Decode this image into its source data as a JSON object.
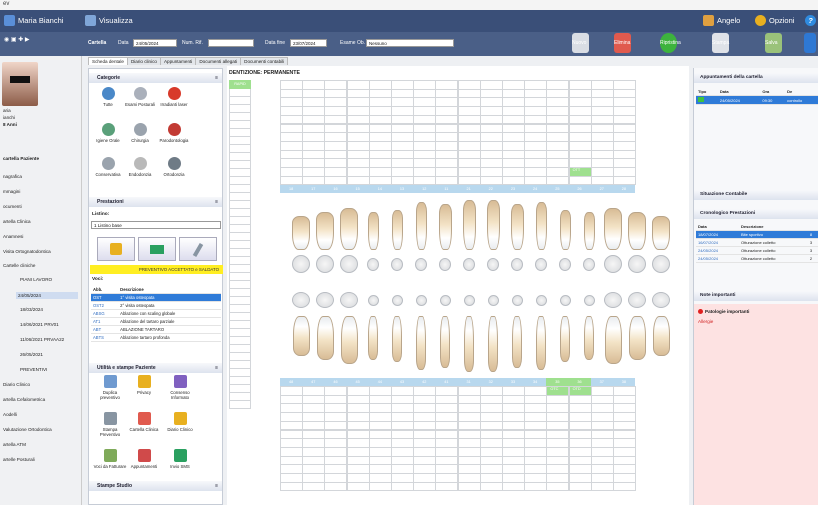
{
  "window": {
    "title": "ev"
  },
  "topbar": {
    "user": "Maria Bianchi",
    "view": "Visualizza",
    "operator": "Angelo",
    "options": "Opzioni",
    "help": "?"
  },
  "toolbar": {
    "cartella": "Cartella",
    "data_label": "Data",
    "data_value": "24/05/2024",
    "num_label": "Num. Rif.",
    "num_value": "",
    "data_fine_label": "Data fine",
    "data_fine_value": "23/07/2024",
    "esame_label": "Esame Ob.",
    "esame_value": "Nessuno",
    "nuovo": "Nuovo",
    "elimina": "Elimina",
    "ripristina": "Ripristina",
    "stampa": "Stampa",
    "salva": "Salva"
  },
  "tabs": [
    "Scheda dentale",
    "Diario clinico",
    "Appuntamenti",
    "Documenti allegati",
    "Documenti contabili"
  ],
  "patient": {
    "name1": "aria",
    "name2": "ianchi",
    "age": "8 Anni"
  },
  "leftnav": {
    "heading": "cartella Paziente",
    "items": [
      {
        "label": "nagrafica"
      },
      {
        "label": "mmagini"
      },
      {
        "label": "ocumenti"
      },
      {
        "label": "artella Clinica"
      },
      {
        "label": "Anamnesi"
      },
      {
        "label": "Visita Ortognatodontica"
      },
      {
        "label": "Cartelle cliniche"
      },
      {
        "label": "PIANI LAVORO"
      },
      {
        "label": "24/05/2024"
      },
      {
        "label": "18/03/2024"
      },
      {
        "label": "14/06/2021 PRV01"
      },
      {
        "label": "11/06/2021 PRVAA22"
      },
      {
        "label": "26/05/2021"
      },
      {
        "label": "PREVENTIVI"
      },
      {
        "label": "Diario Clinico"
      },
      {
        "label": "artella Cefalometrica"
      },
      {
        "label": "Aodelli"
      },
      {
        "label": "Valutazione Ortodontica"
      },
      {
        "label": "artella ATM"
      },
      {
        "label": "artelle Posturali"
      }
    ]
  },
  "categorie": {
    "title": "Categorie",
    "items": [
      {
        "label": "Tutte",
        "icon": "all-icon",
        "color": "#4a88c8"
      },
      {
        "label": "Esami Posturali",
        "icon": "posture-icon",
        "color": "#aab0bb"
      },
      {
        "label": "Irradianti laser",
        "icon": "laser-icon",
        "color": "#d83a2a"
      },
      {
        "label": "Igiene Orale",
        "icon": "toothbrush-icon",
        "color": "#5aa07a"
      },
      {
        "label": "Chirurgia",
        "icon": "scalpel-icon",
        "color": "#9aa3ad"
      },
      {
        "label": "Parodontologia",
        "icon": "gum-icon",
        "color": "#c23a33"
      },
      {
        "label": "Conservativa",
        "icon": "filling-icon",
        "color": "#9aa3ad"
      },
      {
        "label": "Endodonzia",
        "icon": "root-icon",
        "color": "#b9b9b9"
      },
      {
        "label": "Ortodonzia",
        "icon": "brace-icon",
        "color": "#6f7b86"
      }
    ]
  },
  "prestazioni": {
    "title": "Prestazioni",
    "listino_label": "Listino:",
    "listino_value": "1 Listino base",
    "banner": "PREVENTIVO ACCETTATO e SALDATO",
    "voci_label": "Voci:",
    "headers": [
      "Abb.",
      "Descrizione"
    ],
    "rows": [
      {
        "abb": "OST",
        "desc": "1° visita osteopata"
      },
      {
        "abb": "OST2",
        "desc": "2° visita osteopata"
      },
      {
        "abb": "ABSG",
        "desc": "Ablazione con scaling globale"
      },
      {
        "abb": "AT1",
        "desc": "Ablazione del tartaro parziale"
      },
      {
        "abb": "ABT",
        "desc": "ABLAZIONE TARTARO"
      },
      {
        "abb": "ABTS",
        "desc": "Ablazione tartaro profonda"
      }
    ]
  },
  "utilita": {
    "title": "Utilità e stampe Paziente",
    "items": [
      {
        "label": "Duplica preventivo"
      },
      {
        "label": "Privacy"
      },
      {
        "label": "Consenso Informato"
      },
      {
        "label": "Stampa Preventivo"
      },
      {
        "label": "Cartella Clinica"
      },
      {
        "label": "Diario Clinico"
      },
      {
        "label": "Voci da Fatturare"
      },
      {
        "label": "Appuntamenti"
      },
      {
        "label": "Invio SMS"
      }
    ]
  },
  "stampe": {
    "title": "Stampe Studio"
  },
  "chart": {
    "title": "DENTIZIONE: PERMANENTE",
    "side_label": "RAPID",
    "upper_numbers": [
      "18",
      "17",
      "16",
      "15",
      "14",
      "13",
      "12",
      "11",
      "21",
      "22",
      "23",
      "24",
      "25",
      "26",
      "27",
      "28"
    ],
    "lower_numbers": [
      "48",
      "47",
      "46",
      "45",
      "44",
      "43",
      "42",
      "41",
      "31",
      "32",
      "33",
      "34",
      "35",
      "36",
      "37",
      "38"
    ],
    "upper_tag": "OTT",
    "lower_tags": [
      "OTC",
      "OTD"
    ]
  },
  "right": {
    "appuntamenti_title": "Appuntamenti della cartella",
    "app_headers": [
      "Tipo",
      "Data",
      "Ora",
      "De"
    ],
    "app_rows": [
      {
        "data": "24/05/2024",
        "ora": "09:30",
        "desc": "controllo"
      }
    ],
    "situazione": "Situazione Contabile",
    "cronologico": "Cronologico Prestazioni",
    "cron_headers": [
      "Data",
      "Descrizione",
      ""
    ],
    "cron_rows": [
      {
        "data": "18/07/2024",
        "desc": "Bite sportivo",
        "x": "8"
      },
      {
        "data": "16/07/2024",
        "desc": "Otturazione colletto",
        "x": "3"
      },
      {
        "data": "24/05/2024",
        "desc": "Otturazione colletto",
        "x": "3"
      },
      {
        "data": "24/05/2024",
        "desc": "Otturazione colletto",
        "x": "2"
      }
    ],
    "note": "Note importanti",
    "patologie": "Patologie importanti",
    "allergie": "Allergie"
  }
}
